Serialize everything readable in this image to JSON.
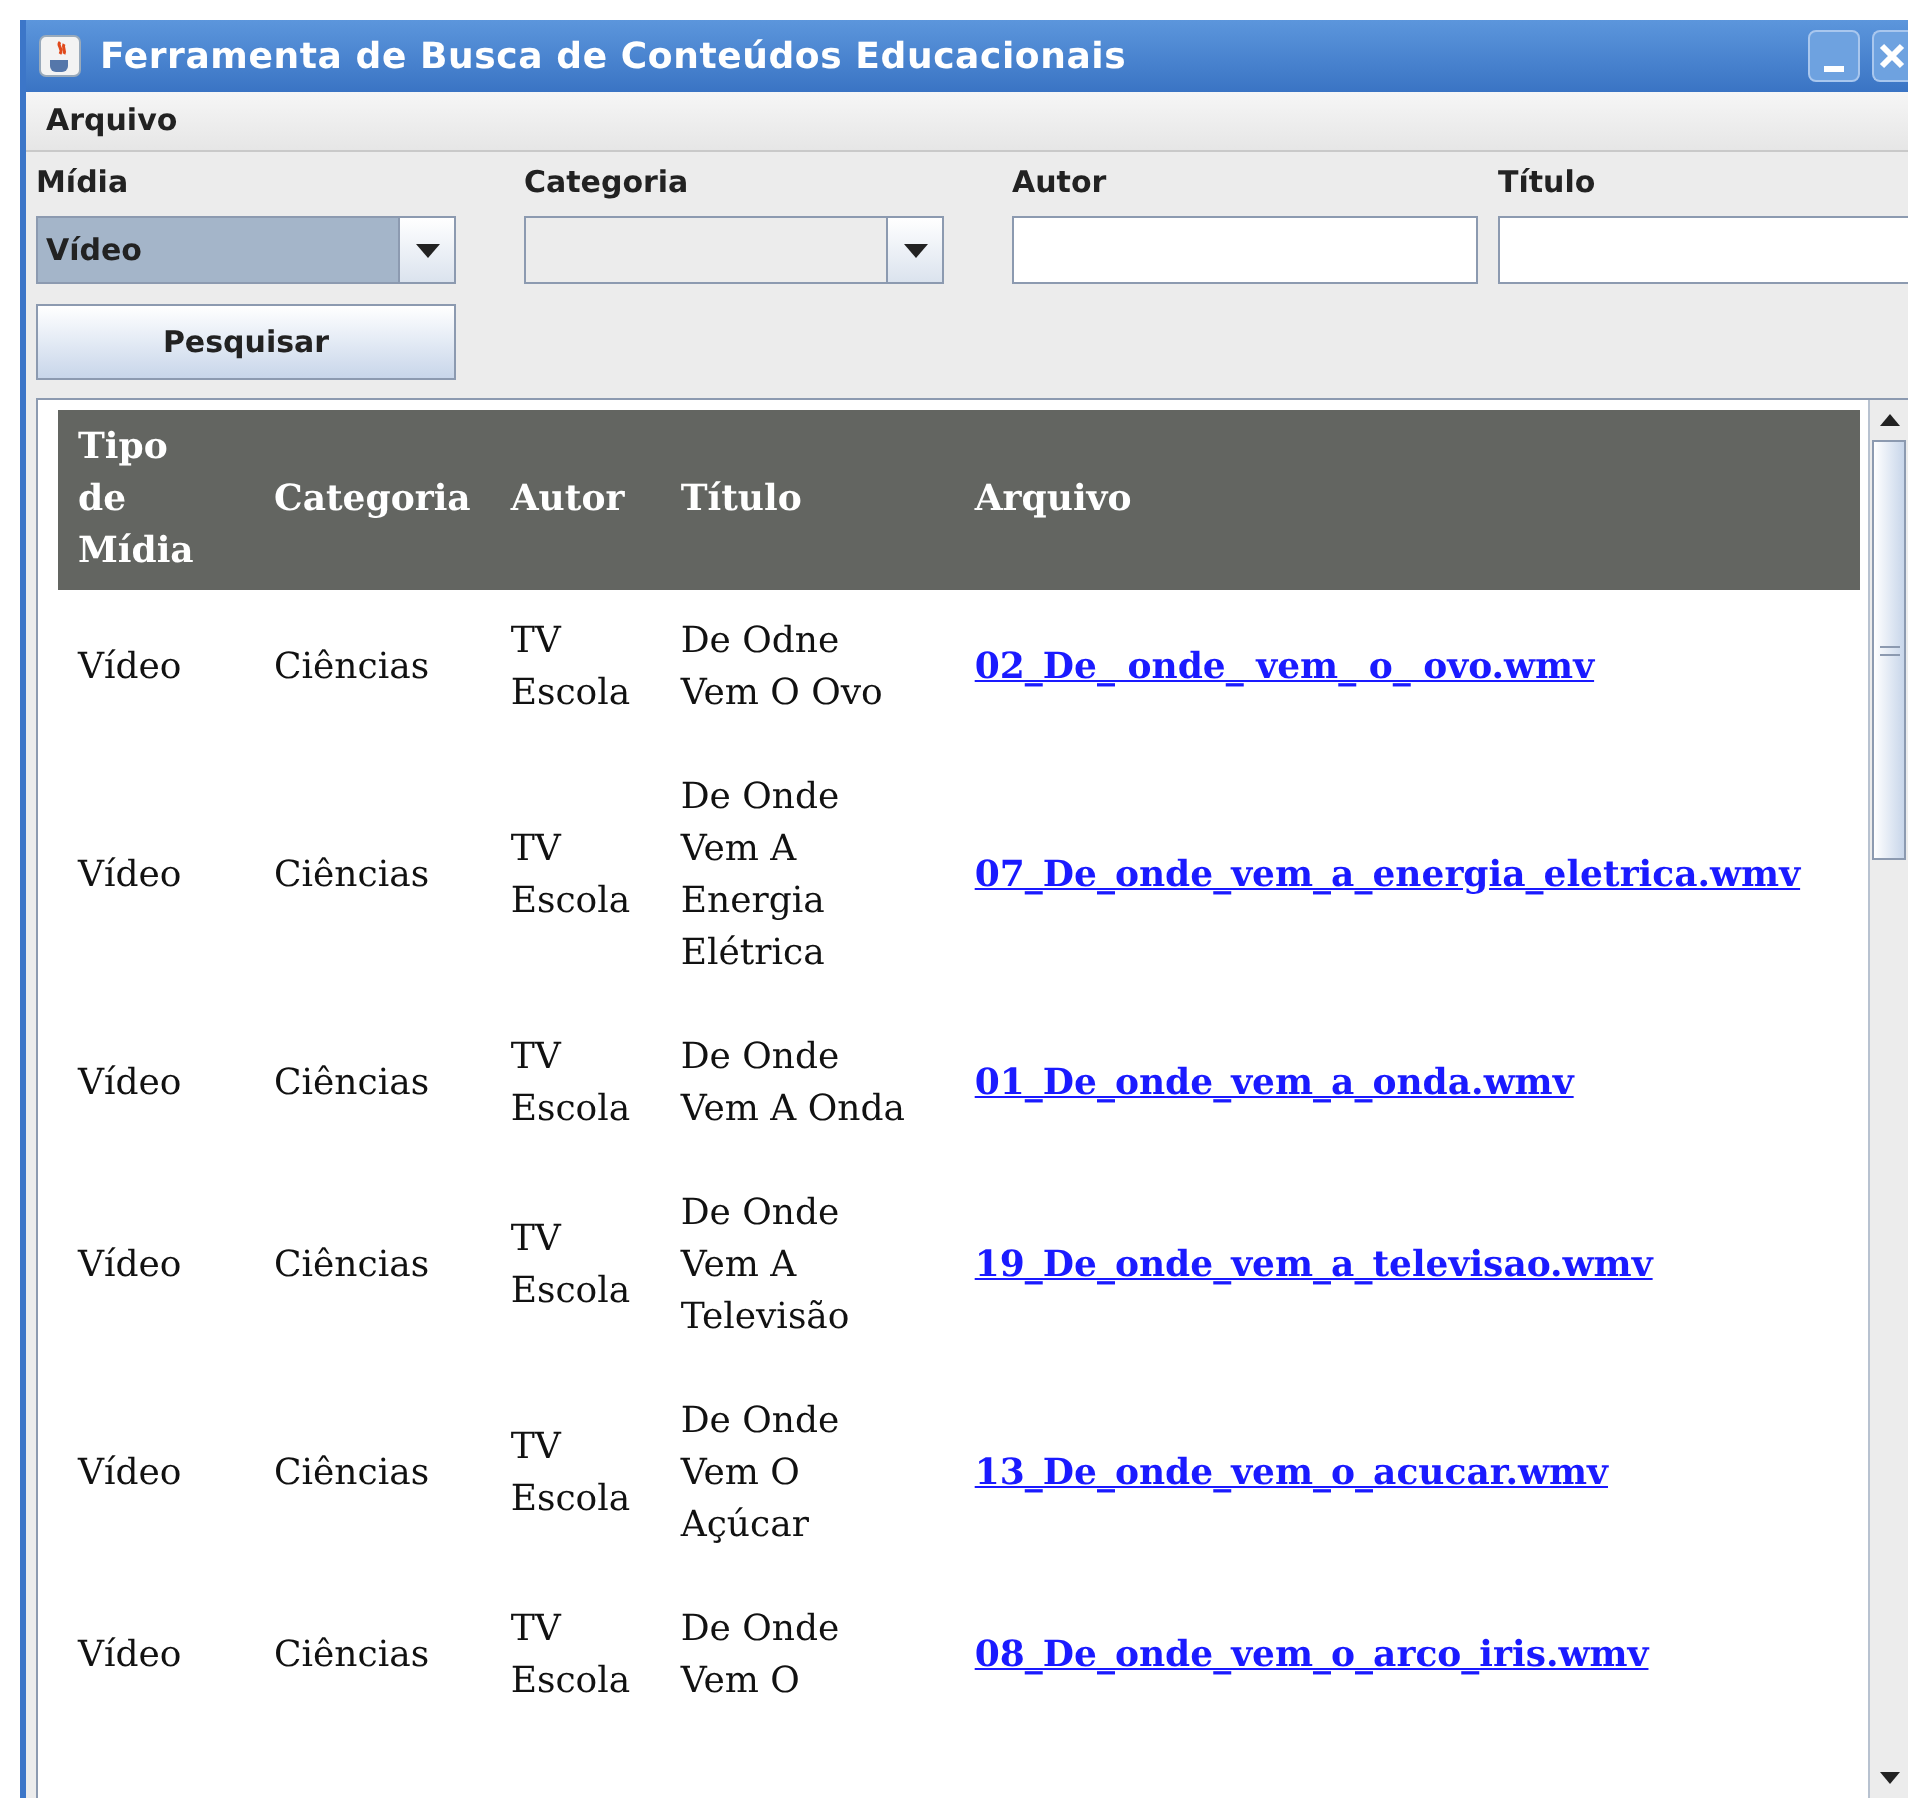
{
  "window": {
    "title": "Ferramenta de Busca de Conteúdos Educacionais"
  },
  "menu": [
    "Arquivo"
  ],
  "filters": [
    {
      "kind": "combo",
      "label": "Mídia",
      "value": "Vídeo",
      "focused": true
    },
    {
      "kind": "combo",
      "label": "Categoria",
      "focused": false
    },
    {
      "kind": "text",
      "label": "Autor"
    },
    {
      "kind": "text",
      "label": "Título"
    }
  ],
  "search_button": "Pesquisar",
  "table": {
    "columns": [
      "Tipo de Mídia",
      "Categoria",
      "Autor",
      "Título",
      "Arquivo"
    ],
    "rows": [
      [
        "Vídeo",
        "Ciências",
        "TV Escola",
        "De Odne Vem O Ovo",
        "02_De_ onde_ vem_ o_ ovo.wmv"
      ],
      [
        "Vídeo",
        "Ciências",
        "TV Escola",
        "De Onde Vem A Energia Elétrica",
        "07_De_onde_vem_a_energia_eletrica.wmv"
      ],
      [
        "Vídeo",
        "Ciências",
        "TV Escola",
        "De Onde Vem A Onda",
        "01_De_onde_vem_a_onda.wmv"
      ],
      [
        "Vídeo",
        "Ciências",
        "TV Escola",
        "De Onde Vem A Televisão",
        "19_De_onde_vem_a_televisao.wmv"
      ],
      [
        "Vídeo",
        "Ciências",
        "TV Escola",
        "De Onde Vem O Açúcar",
        "13_De_onde_vem_o_acucar.wmv"
      ],
      [
        "Vídeo",
        "Ciências",
        "TV Escola",
        "De Onde Vem O",
        "08_De_onde_vem_o_arco_iris.wmv"
      ]
    ]
  }
}
